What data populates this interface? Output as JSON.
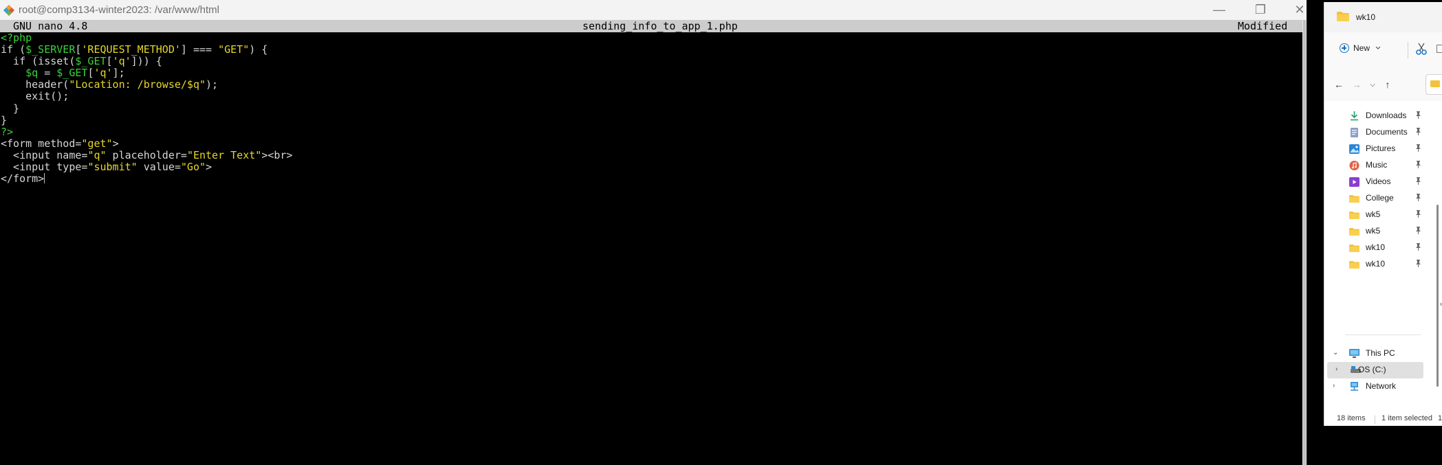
{
  "terminal": {
    "window_title": "root@comp3134-winter2023: /var/www/html",
    "minimize_glyph": "—",
    "maximize_glyph": "❐",
    "close_glyph": "✕",
    "nano": {
      "version": "GNU nano 4.8",
      "filename": "sending_info_to_app_1.php",
      "status": "Modified"
    },
    "code_lines": [
      "<?php",
      "if ($_SERVER['REQUEST_METHOD'] === \"GET\") {",
      "  if (isset($_GET['q'])) {",
      "    $q = $_GET['q'];",
      "    header(\"Location: /browse/$q\");",
      "    exit();",
      "  }",
      "}",
      "?>",
      "<form method=\"get\">",
      "  <input name=\"q\" placeholder=\"Enter Text\"><br>",
      "  <input type=\"submit\" value=\"Go\">",
      "</form>"
    ]
  },
  "explorer": {
    "title": "wk10",
    "toolbar": {
      "new_label": "New"
    },
    "quick_access": [
      {
        "label": "Downloads",
        "icon": "download-icon",
        "pinned": true
      },
      {
        "label": "Documents",
        "icon": "documents-icon",
        "pinned": true
      },
      {
        "label": "Pictures",
        "icon": "pictures-icon",
        "pinned": true
      },
      {
        "label": "Music",
        "icon": "music-icon",
        "pinned": true
      },
      {
        "label": "Videos",
        "icon": "videos-icon",
        "pinned": true
      },
      {
        "label": "College",
        "icon": "folder-icon",
        "pinned": true
      },
      {
        "label": "wk5",
        "icon": "folder-icon",
        "pinned": true
      },
      {
        "label": "wk5",
        "icon": "folder-icon",
        "pinned": true
      },
      {
        "label": "wk10",
        "icon": "folder-icon",
        "pinned": true
      },
      {
        "label": "wk10",
        "icon": "folder-icon",
        "pinned": true
      }
    ],
    "this_pc": "This PC",
    "drive": "OS (C:)",
    "network": "Network",
    "status": {
      "items": "18 items",
      "selected": "1 item selected",
      "more": "1"
    }
  },
  "colors": {
    "terminal_bg": "#000000",
    "code_default": "#dcdcdc",
    "code_variable": "#3ad43a",
    "code_string": "#e6d72c",
    "folder_yellow": "#f4c23a",
    "accent_blue": "#1a6fbf"
  }
}
